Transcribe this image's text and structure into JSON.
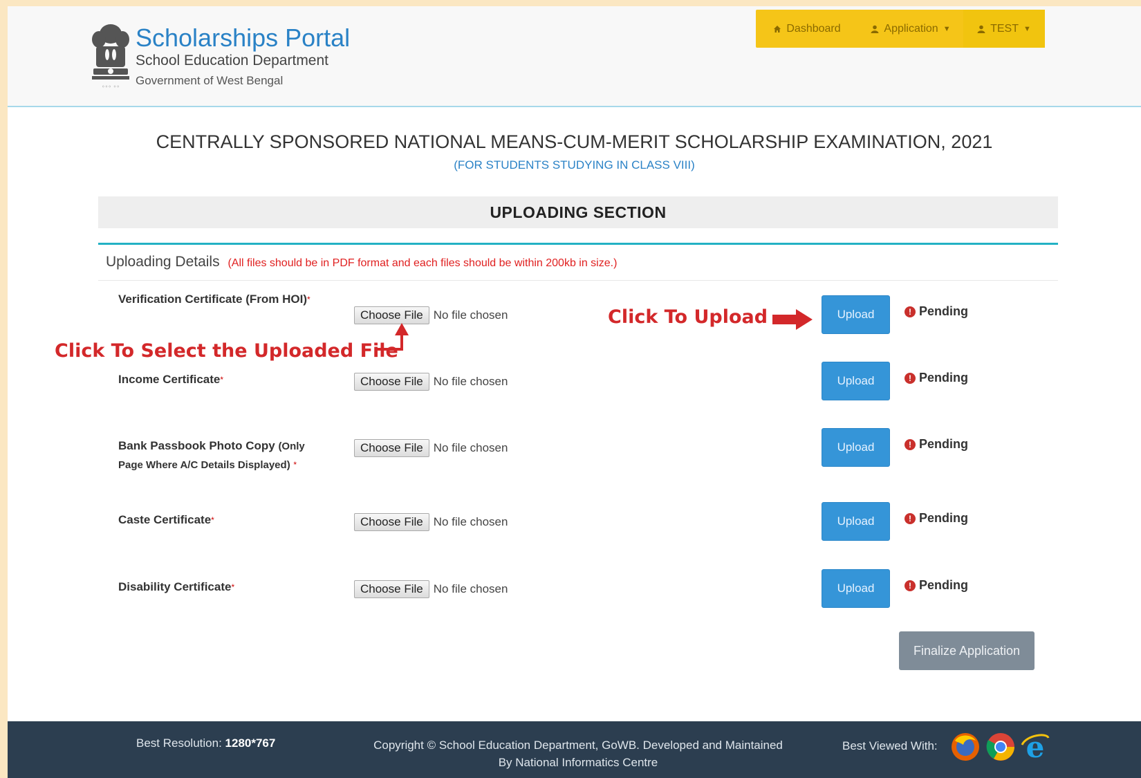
{
  "header": {
    "title": "Scholarships Portal",
    "department": "School Education Department",
    "government": "Government of West Bengal",
    "nav": {
      "dashboard": "Dashboard",
      "application": "Application",
      "user": "TEST"
    }
  },
  "exam": {
    "title": "CENTRALLY SPONSORED NATIONAL MEANS-CUM-MERIT SCHOLARSHIP EXAMINATION, 2021",
    "subtitle": "(FOR STUDENTS STUDYING IN CLASS VIII)"
  },
  "section": {
    "title": "UPLOADING SECTION",
    "details_label": "Uploading Details",
    "details_note": "(All files should be in PDF format and each files should be within 200kb in size.)"
  },
  "file_input": {
    "choose_label": "Choose File",
    "no_file": "No file chosen"
  },
  "upload_label": "Upload",
  "status_label": "Pending",
  "documents": [
    {
      "label": "Verification Certificate (From HOI)"
    },
    {
      "label": "Income Certificate"
    },
    {
      "label": "Bank Passbook Photo Copy",
      "note_line1": "(Only",
      "note_line2": "Page Where A/C Details Displayed)"
    },
    {
      "label": "Caste Certificate"
    },
    {
      "label": "Disability Certificate"
    }
  ],
  "finalize_label": "Finalize Application",
  "annotations": {
    "upload_hint": "Click To Upload",
    "select_hint": "Click To Select the Uploaded File"
  },
  "footer": {
    "resolution_label": "Best Resolution:",
    "resolution_value": "1280*767",
    "copyright_line1": "Copyright © School Education Department, GoWB.    Developed and Maintained",
    "copyright_line2": "By National Informatics Centre",
    "viewed_with": "Best Viewed With:",
    "browsers": [
      "firefox-icon",
      "chrome-icon",
      "internet-explorer-icon"
    ]
  },
  "colors": {
    "brand_blue": "#2a82c6",
    "nav_yellow": "#f5c518",
    "upload_blue": "#3595d8",
    "pending_red": "#c9302c",
    "annotation_red": "#d3282a",
    "footer_bg": "#2c3e50"
  }
}
